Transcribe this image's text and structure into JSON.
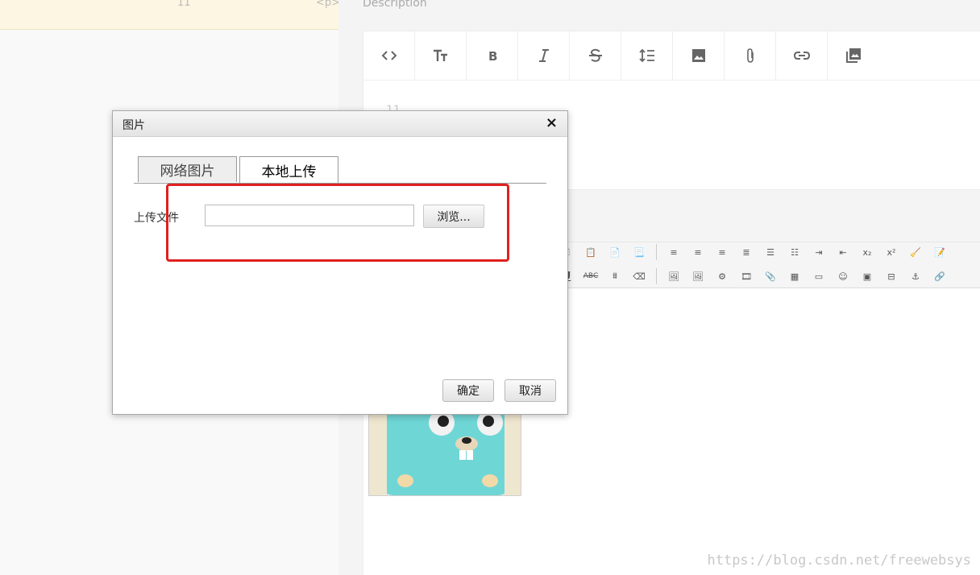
{
  "background": {
    "line_number": "11",
    "tag_text": "<p>",
    "description_label": "Description",
    "md_content": "11",
    "watermark": "https://blog.csdn.net/freewebsys"
  },
  "md_toolbar": [
    "code-icon",
    "text-size-icon",
    "bold-icon",
    "italic-icon",
    "strikethrough-icon",
    "line-height-icon",
    "image-icon",
    "attachment-icon",
    "link-icon",
    "gallery-icon"
  ],
  "dialog": {
    "title": "图片",
    "close_label": "×",
    "tabs": [
      {
        "label": "网络图片",
        "active": false
      },
      {
        "label": "本地上传",
        "active": true
      }
    ],
    "upload_label": "上传文件",
    "file_value": "",
    "browse_label": "浏览...",
    "ok_label": "确定",
    "cancel_label": "取消"
  },
  "colors": {
    "highlight": "#e02020",
    "gopher": "#66d3d6"
  }
}
